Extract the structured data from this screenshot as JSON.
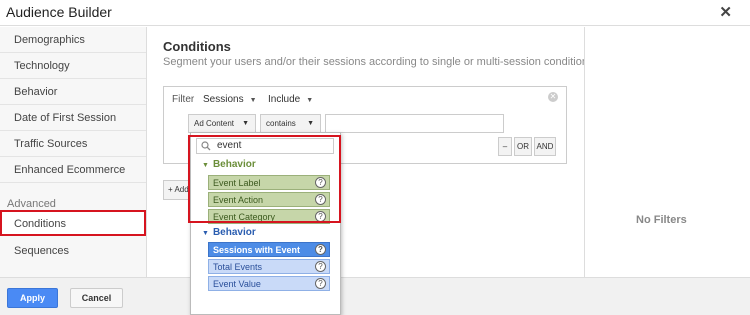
{
  "window": {
    "title": "Audience Builder",
    "close_glyph": "✕"
  },
  "sidebar": {
    "items": [
      {
        "label": "Demographics"
      },
      {
        "label": "Technology"
      },
      {
        "label": "Behavior"
      },
      {
        "label": "Date of First Session"
      },
      {
        "label": "Traffic Sources"
      },
      {
        "label": "Enhanced Ecommerce"
      }
    ],
    "section_label": "Advanced",
    "advanced_items": [
      {
        "label": "Conditions",
        "selected": true
      },
      {
        "label": "Sequences"
      }
    ]
  },
  "main": {
    "title": "Conditions",
    "subtitle": "Segment your users and/or their sessions according to single or multi-session conditions.",
    "filter": {
      "label": "Filter",
      "scope": "Sessions",
      "mode": "Include",
      "dimension": "Ad Content",
      "operator": "contains",
      "value": "",
      "logic_buttons": [
        "–",
        "OR",
        "AND"
      ]
    },
    "add_button": "+ Add"
  },
  "right_panel": {
    "empty_text": "No Filters"
  },
  "footer": {
    "apply": "Apply",
    "cancel": "Cancel"
  },
  "dropdown": {
    "search_value": "event",
    "groups": [
      {
        "label": "Behavior",
        "color": "#6b8e3a",
        "options": [
          "Event Label",
          "Event Action",
          "Event Category"
        ]
      },
      {
        "label": "Behavior",
        "color": "#2a5db0",
        "options": [
          "Sessions with Event",
          "Total Events",
          "Event Value"
        ],
        "selected": "Sessions with Event"
      }
    ]
  },
  "colors": {
    "accent": "#4a8af4",
    "highlight": "#d6141f"
  }
}
